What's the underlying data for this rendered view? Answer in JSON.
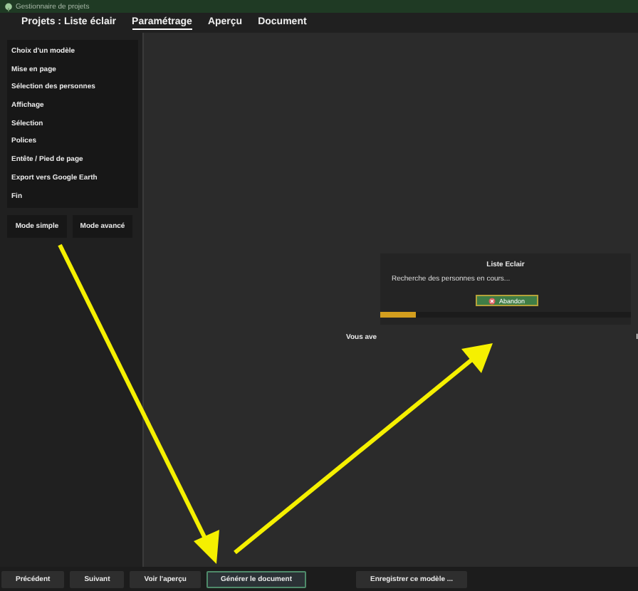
{
  "window": {
    "title": "Gestionnaire de projets"
  },
  "tabs": [
    {
      "label": "Projets : Liste éclair",
      "selected": false
    },
    {
      "label": "Paramétrage",
      "selected": true
    },
    {
      "label": "Aperçu",
      "selected": false
    },
    {
      "label": "Document",
      "selected": false
    }
  ],
  "sidebar": {
    "items": [
      {
        "label": "Choix d'un modèle"
      },
      {
        "label": "Mise en page"
      },
      {
        "label": "Sélection des personnes"
      },
      {
        "label": "Affichage"
      },
      {
        "label": "Sélection"
      },
      {
        "label": "Polices"
      },
      {
        "label": "Entête / Pied de page"
      },
      {
        "label": "Export vers Google Earth"
      },
      {
        "label": "Fin"
      }
    ],
    "buttons": [
      "Mode simple",
      "Mode avancé"
    ]
  },
  "main": {
    "text_left": "Vous ave",
    "text_right": "l"
  },
  "dialog": {
    "title": "Liste Eclair",
    "message": "Recherche des personnes en cours...",
    "button": "Abandon",
    "level": 0.14
  },
  "footer": {
    "buttons": [
      {
        "label": "Précédent",
        "selected": false
      },
      {
        "label": "Suivant",
        "selected": false
      },
      {
        "label": "Voir l'aperçu",
        "selected": false
      },
      {
        "label": "Générer le document",
        "selected": true
      },
      {
        "label": "Enregistrer ce modèle ...",
        "selected": false
      }
    ]
  }
}
